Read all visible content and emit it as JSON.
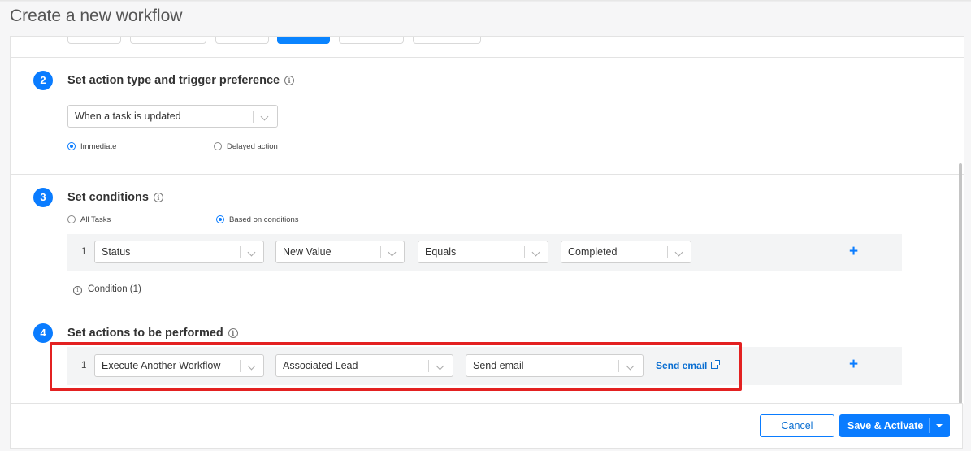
{
  "page": {
    "title": "Create a new workflow"
  },
  "section2": {
    "step": "2",
    "title": "Set action type and trigger preference",
    "trigger_select": "When a task is updated",
    "radios": [
      {
        "label": "Immediate",
        "selected": true
      },
      {
        "label": "Delayed action",
        "selected": false
      }
    ]
  },
  "section3": {
    "step": "3",
    "title": "Set conditions",
    "radios": [
      {
        "label": "All Tasks",
        "selected": false
      },
      {
        "label": "Based on conditions",
        "selected": true
      }
    ],
    "row": {
      "index": "1",
      "field": "Status",
      "value_type": "New Value",
      "operator": "Equals",
      "value": "Completed",
      "add": "+"
    },
    "condition_note": "Condition (1)"
  },
  "section4": {
    "step": "4",
    "title": "Set actions to be performed",
    "row": {
      "index": "1",
      "action": "Execute Another Workflow",
      "target": "Associated Lead",
      "workflow": "Send email",
      "link": "Send email",
      "add": "+"
    }
  },
  "footer": {
    "cancel_label": "Cancel",
    "save_label": "Save & Activate"
  },
  "colors": {
    "accent": "#0a7cff",
    "highlight": "#e32121"
  }
}
